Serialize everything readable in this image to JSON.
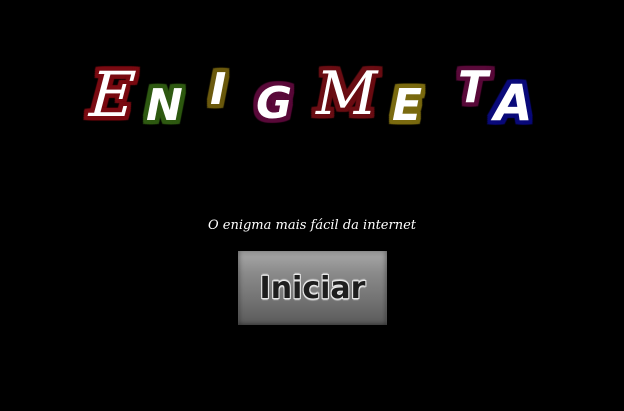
{
  "title": {
    "letters": [
      {
        "char": "E",
        "glow": "#7a0b12"
      },
      {
        "char": "N",
        "glow": "#2f5a12"
      },
      {
        "char": "I",
        "glow": "#6b5a0e"
      },
      {
        "char": "G",
        "glow": "#5a0a3a"
      },
      {
        "char": "M",
        "glow": "#6b0e14"
      },
      {
        "char": "E",
        "glow": "#7a6a10"
      },
      {
        "char": "T",
        "glow": "#5a0a3a"
      },
      {
        "char": "A",
        "glow": "#0a0a7a"
      }
    ]
  },
  "tagline": "O enigma mais fácil da internet",
  "start_button": {
    "label": "Iniciar"
  }
}
